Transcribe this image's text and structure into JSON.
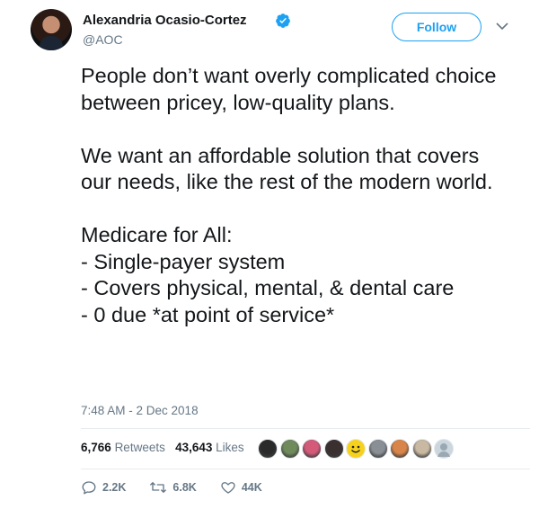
{
  "author": {
    "name": "Alexandria Ocasio-Cortez",
    "handle": "@AOC",
    "verified": true
  },
  "follow_label": "Follow",
  "tweet": {
    "text": "People don’t want overly complicated choice between pricey, low-quality plans.\n\nWe want an affordable solution that covers our needs, like the rest of the modern world.\n\nMedicare for All:\n- Single-payer system\n- Covers physical, mental, & dental care\n- 0 due *at point of service*",
    "timestamp": "7:48 AM - 2 Dec 2018"
  },
  "stats": {
    "retweets_count": "6,766",
    "retweets_label": "Retweets",
    "likes_count": "43,643",
    "likes_label": "Likes"
  },
  "liker_avatars": [
    {
      "icon": "avatar-dark-icon",
      "color": "#2a2a2a"
    },
    {
      "icon": "avatar-landscape-icon",
      "color": "#6f8a5b"
    },
    {
      "icon": "avatar-pink-icon",
      "color": "#d45a7a"
    },
    {
      "icon": "avatar-dark-hair-icon",
      "color": "#3a3030"
    },
    {
      "icon": "smiley-icon",
      "color": "#f7d21c"
    },
    {
      "icon": "avatar-gray-icon",
      "color": "#8a8f95"
    },
    {
      "icon": "avatar-orange-icon",
      "color": "#d9854a"
    },
    {
      "icon": "avatar-beige-icon",
      "color": "#c9b9a2"
    },
    {
      "icon": "default-avatar-icon",
      "color": "#ccd6dd"
    }
  ],
  "actions": {
    "replies": "2.2K",
    "retweets": "6.8K",
    "likes": "44K"
  },
  "colors": {
    "accent": "#1da1f2",
    "text": "#14171a",
    "muted": "#657786"
  }
}
